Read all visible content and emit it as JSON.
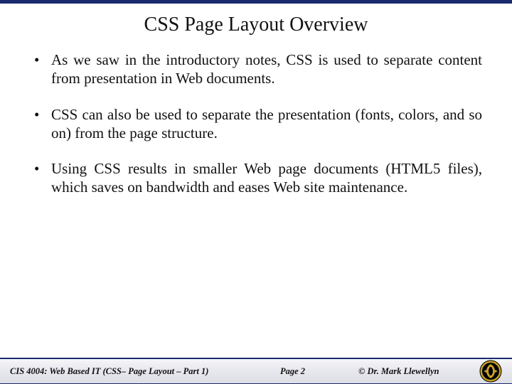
{
  "slide": {
    "title": "CSS Page Layout Overview",
    "bullets": [
      "As we saw in the introductory notes, CSS is used to separate content from presentation in Web documents.",
      "CSS can also be used to separate the presentation (fonts, colors, and so on) from the page structure.",
      "Using CSS results in smaller Web page documents (HTML5 files), which saves on bandwidth and eases Web site maintenance."
    ]
  },
  "footer": {
    "course": "CIS 4004: Web Based IT (CSS– Page Layout – Part 1)",
    "page": "Page 2",
    "copyright": "© Dr. Mark Llewellyn"
  }
}
